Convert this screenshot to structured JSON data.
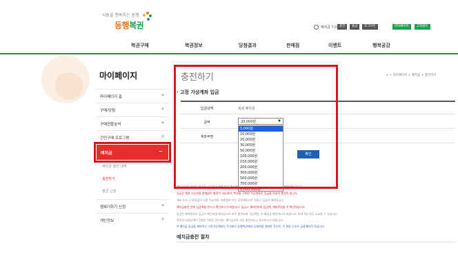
{
  "header": {
    "tagline": "사람을 행복하는 동행",
    "logo_main": "동행",
    "logo_accent": "복권",
    "balance_label": "예치금 7,000원",
    "buttons": [
      "충전",
      "출금",
      "로그아웃"
    ],
    "green_buttons": [
      "마이페이지",
      "고객센터"
    ]
  },
  "nav": [
    "복권구매",
    "복권정보",
    "당첨결과",
    "판매점",
    "이벤트",
    "행복공감"
  ],
  "sidebar": {
    "title": "마이페이지",
    "items": [
      {
        "label": "마이페이지 홈",
        "toggle": "+"
      },
      {
        "label": "구매/당첨",
        "toggle": "+"
      },
      {
        "label": "구매현황분석",
        "toggle": "+"
      },
      {
        "label": "건전구매 프로그램",
        "toggle": "+"
      }
    ],
    "active": {
      "label": "예치금",
      "toggle": "−"
    },
    "subitems": [
      "· 예치금 충전 내역",
      "· 충전하기",
      "· 출금 신청"
    ],
    "bottom_items": [
      {
        "label": "행복더하기 신청",
        "toggle": "+"
      },
      {
        "label": "개인정보",
        "toggle": "+"
      }
    ]
  },
  "main": {
    "page_title": "충전하기",
    "breadcrumb": "⌂ > 마이페이지 > 예치금 > 충전하기",
    "section_title": "· 고정 가상계좌 입금",
    "form": {
      "row1_label": "입금내역",
      "row1_value": "복권 예치금",
      "row2_label": "금액",
      "row3_label": "계좌주명",
      "selected": "20,000원",
      "options": [
        "5,000원",
        "10,000원",
        "20,000원",
        "30,000원",
        "50,000원",
        "100,000원",
        "150,000원",
        "200,000원",
        "300,000원",
        "500,000원",
        "700,000원",
        "1,000,000원"
      ],
      "highlighted_option": "5,000원",
      "confirm": "확인"
    },
    "notices": [
      {
        "text": "예치금이란 인터넷 복권을 구입하기 위해 미리 충전하는 금액으로 구매 시 예치금으로 구매를 결제하게 됩니다.",
        "style": "gray"
      },
      {
        "text": "입금은 계좌 소유자와 관계없이 충전이 가능하며, 복권을 구매한 가상계좌로 입금을 하셔야 충전이 됩니다.",
        "style": "red"
      },
      {
        "text": "계좌 유지 시 변경없이 사용 가능하며, 회원탈퇴 또는 휴면계정으로 전환시 입금이 제한됩니다.",
        "style": "gray"
      },
      {
        "text": "예치금충전 전에 입금액을 반드시 확인하시기 바랍니다. 입금시 계좌번호와 입금액, 계좌주명을 꼭 확인하십시오.",
        "style": "red"
      },
      {
        "text": "입금된 계좌번호로 입금이 확인되면 예치금으로 바로 충전되며, 입금확인 후 예치금 확인하시기 바랍니다. 최대 5분 정도 소요될 수 있습니다.",
        "style": "gray"
      },
      {
        "text": "복권의 당첨금액이 5만원 이하인 경우에는 예치금으로 자동 충전되오니 참고하시기 바랍니다.",
        "style": "gray"
      },
      {
        "text": "※ 예치금 입금을 제외하고 고정가상계좌는 주식회사 동행복권에서 무재하를 개설한 것으로, 각 회원 소유의 금융계좌가 아닙니다.",
        "style": "blue"
      }
    ],
    "procedure_title": "예치금충전 절차"
  },
  "colors": {
    "accent_red": "#d9141d",
    "brand_green": "#1aa04a",
    "select_blue": "#1e62d8"
  }
}
